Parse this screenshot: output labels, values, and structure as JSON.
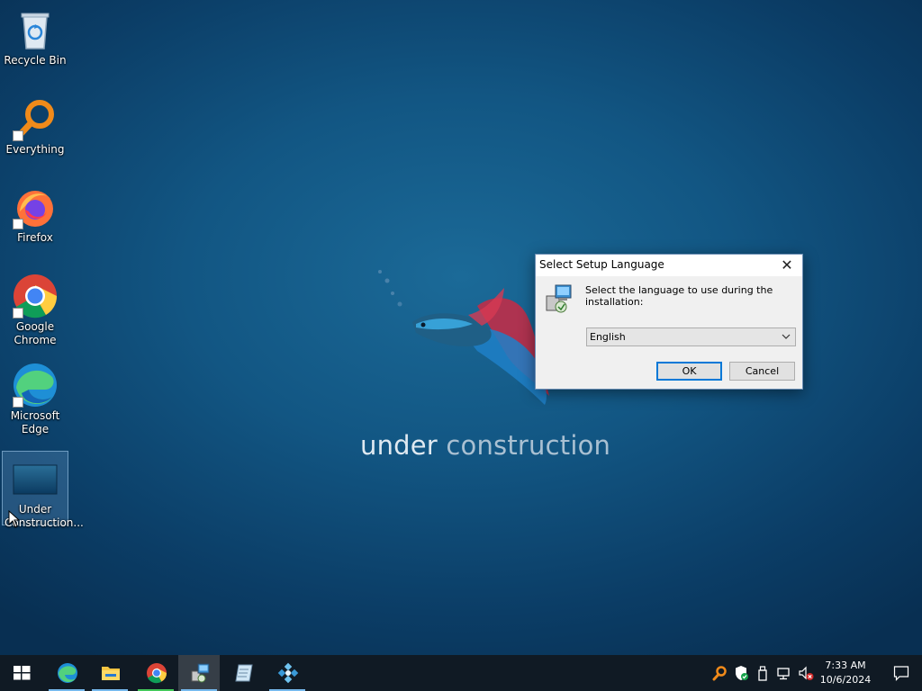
{
  "desktop": {
    "icons": [
      {
        "label": "Recycle Bin"
      },
      {
        "label": "Everything"
      },
      {
        "label": "Firefox"
      },
      {
        "label": "Google Chrome"
      },
      {
        "label": "Microsoft Edge"
      },
      {
        "label": "Under Construction..."
      }
    ],
    "wallpaper_text": {
      "word1": "under",
      "word2": "construction"
    }
  },
  "dialog": {
    "title": "Select Setup Language",
    "close_glyph": "✕",
    "message": "Select the language to use during the installation:",
    "language": {
      "selected": "English"
    },
    "ok_label": "OK",
    "cancel_label": "Cancel"
  },
  "taskbar": {
    "apps": [
      "start-icon",
      "edge-icon",
      "file-explorer-icon",
      "chrome-icon",
      "setup-icon",
      "notepad-icon",
      "app-icon"
    ],
    "tray_icons": [
      "everything-icon",
      "defender-icon",
      "usb-icon",
      "network-icon",
      "volume-muted-icon"
    ],
    "clock": {
      "time": "7:33 AM",
      "date": "10/6/2024"
    }
  },
  "colors": {
    "taskbar": "#101a24",
    "accent": "#0078d7",
    "dialog_bg": "#f0f0f0"
  }
}
